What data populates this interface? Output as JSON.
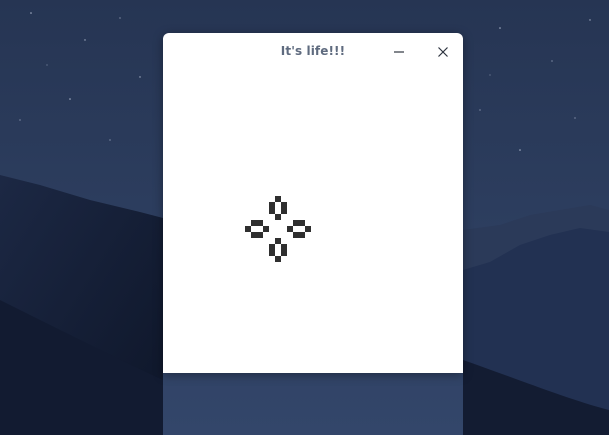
{
  "window": {
    "title": "It's life!!!",
    "controls": {
      "minimize_icon": "minimize-icon",
      "close_icon": "close-icon"
    }
  },
  "game": {
    "alive_color": "#2f2f2f",
    "background_color": "#ffffff",
    "live_cells": [
      [
        6,
        0
      ],
      [
        5,
        1
      ],
      [
        7,
        1
      ],
      [
        5,
        2
      ],
      [
        7,
        2
      ],
      [
        6,
        3
      ],
      [
        2,
        4
      ],
      [
        3,
        4
      ],
      [
        9,
        4
      ],
      [
        10,
        4
      ],
      [
        1,
        5
      ],
      [
        4,
        5
      ],
      [
        8,
        5
      ],
      [
        11,
        5
      ],
      [
        2,
        6
      ],
      [
        3,
        6
      ],
      [
        9,
        6
      ],
      [
        10,
        6
      ],
      [
        6,
        7
      ],
      [
        5,
        8
      ],
      [
        7,
        8
      ],
      [
        5,
        9
      ],
      [
        7,
        9
      ],
      [
        6,
        10
      ]
    ]
  }
}
